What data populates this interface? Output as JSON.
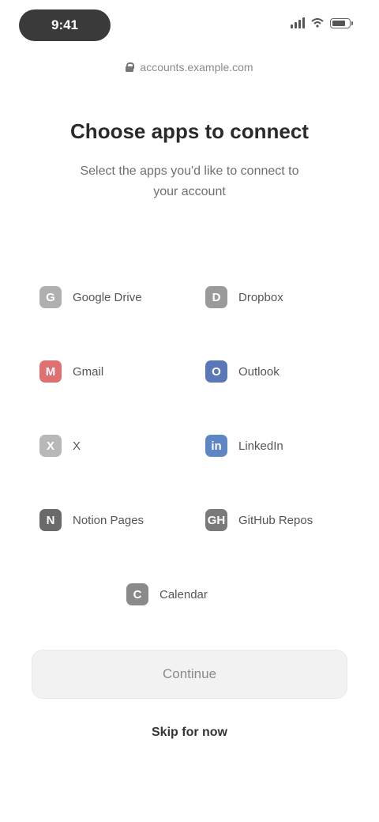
{
  "status_bar": {
    "time": "9:41"
  },
  "url_bar": {
    "url": "accounts.example.com"
  },
  "heading": {
    "title": "Choose apps to connect",
    "subtitle": "Select the apps you'd like to connect to your account"
  },
  "apps": [
    {
      "label": "Google Drive",
      "icon": "G",
      "color": "#b0b0b0"
    },
    {
      "label": "Dropbox",
      "icon": "D",
      "color": "#9a9a9a"
    },
    {
      "label": "Gmail",
      "icon": "M",
      "color": "#e07070"
    },
    {
      "label": "Outlook",
      "icon": "O",
      "color": "#5a78b8"
    },
    {
      "label": "X",
      "icon": "X",
      "color": "#b8b8b8"
    },
    {
      "label": "LinkedIn",
      "icon": "in",
      "color": "#5f86c4"
    },
    {
      "label": "Notion Pages",
      "icon": "N",
      "color": "#6a6a6a"
    },
    {
      "label": "GitHub Repos",
      "icon": "GH",
      "color": "#7a7a7a"
    },
    {
      "label": "Calendar",
      "icon": "C",
      "color": "#8a8a8a"
    }
  ],
  "actions": {
    "continue_label": "Continue",
    "skip_label": "Skip for now"
  }
}
